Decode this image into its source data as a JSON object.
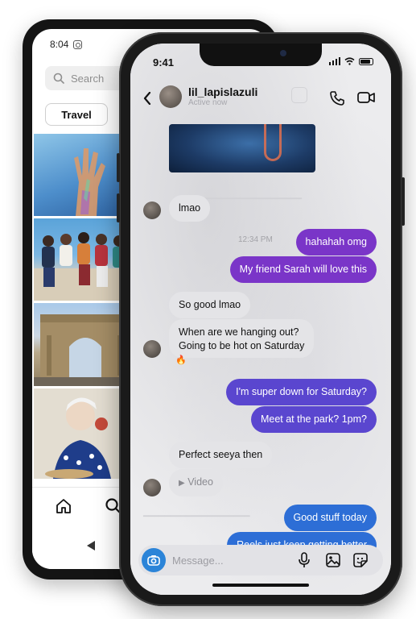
{
  "back_phone": {
    "time": "8:04",
    "search_placeholder": "Search",
    "chip_label": "Travel",
    "icons": [
      "camera-status-icon",
      "search-icon",
      "home-icon",
      "android-back-icon"
    ]
  },
  "front_phone": {
    "time": "9:41",
    "header": {
      "username": "lil_lapislazuli",
      "status": "Active now"
    },
    "timestamp": "12:34 PM",
    "messages": [
      {
        "direction": "in",
        "text": "lmao"
      },
      {
        "direction": "out",
        "text": "hahahah omg"
      },
      {
        "direction": "out",
        "text": "My friend Sarah will love this"
      },
      {
        "direction": "in",
        "text": "So good lmao"
      },
      {
        "direction": "in",
        "text": "When are we hanging out?"
      },
      {
        "direction": "in",
        "text": "Going to be hot on Saturday"
      },
      {
        "direction": "in",
        "text": "🔥"
      },
      {
        "direction": "out",
        "text": "I'm super down for Saturday?"
      },
      {
        "direction": "out",
        "text": "Meet at the park? 1pm?"
      },
      {
        "direction": "in",
        "text": "Perfect seeya then"
      },
      {
        "direction": "in",
        "text": "Video"
      },
      {
        "direction": "out",
        "text": "Good stuff today"
      },
      {
        "direction": "out",
        "text": "Reels just keep getting better"
      }
    ],
    "composer": {
      "placeholder": "Message..."
    },
    "colors": {
      "purple": "#7a35c8",
      "indigo": "#5a46cf",
      "blue": "#2d6ed6",
      "incoming": "#e4e4e7"
    }
  }
}
